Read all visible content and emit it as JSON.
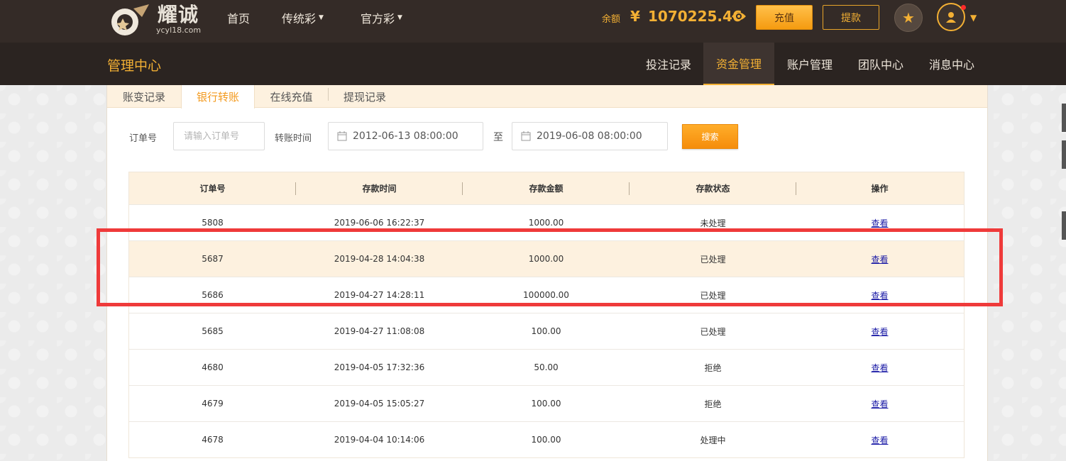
{
  "brand": {
    "name": "耀诚",
    "domain": "ycyl18.com"
  },
  "top_nav": {
    "home": "首页",
    "traditional": "传统彩",
    "official": "官方彩"
  },
  "account": {
    "balance_label": "余额",
    "currency": "¥",
    "balance": "1070225.46",
    "recharge_label": "充值",
    "withdraw_label": "提款"
  },
  "sub_nav": {
    "title": "管理中心",
    "items": [
      {
        "label": "投注记录"
      },
      {
        "label": "资金管理",
        "active": true
      },
      {
        "label": "账户管理"
      },
      {
        "label": "团队中心"
      },
      {
        "label": "消息中心"
      }
    ]
  },
  "tabs": [
    {
      "label": "账变记录"
    },
    {
      "label": "银行转账",
      "active": true
    },
    {
      "label": "在线充值"
    },
    {
      "label": "提现记录"
    }
  ],
  "filters": {
    "order_label": "订单号",
    "order_placeholder": "请输入订单号",
    "time_label": "转账时间",
    "start_time": "2012-06-13 08:00:00",
    "to_label": "至",
    "end_time": "2019-06-08 08:00:00",
    "search_label": "搜索"
  },
  "table": {
    "headers": [
      "订单号",
      "存款时间",
      "存款金额",
      "存款状态",
      "操作"
    ],
    "rows": [
      {
        "order": "5808",
        "time": "2019-06-06 16:22:37",
        "amount": "1000.00",
        "status": "未处理",
        "action": "查看"
      },
      {
        "order": "5687",
        "time": "2019-04-28 14:04:38",
        "amount": "1000.00",
        "status": "已处理",
        "action": "查看"
      },
      {
        "order": "5686",
        "time": "2019-04-27 14:28:11",
        "amount": "100000.00",
        "status": "已处理",
        "action": "查看"
      },
      {
        "order": "5685",
        "time": "2019-04-27 11:08:08",
        "amount": "100.00",
        "status": "已处理",
        "action": "查看"
      },
      {
        "order": "4680",
        "time": "2019-04-05 17:32:36",
        "amount": "50.00",
        "status": "拒绝",
        "action": "查看"
      },
      {
        "order": "4679",
        "time": "2019-04-05 15:05:27",
        "amount": "100.00",
        "status": "拒绝",
        "action": "查看"
      },
      {
        "order": "4678",
        "time": "2019-04-04 10:14:06",
        "amount": "100.00",
        "status": "处理中",
        "action": "查看"
      }
    ]
  },
  "colors": {
    "accent": "#f3b034",
    "topbar": "#342b27",
    "highlight_frame": "#ef3a3a"
  }
}
